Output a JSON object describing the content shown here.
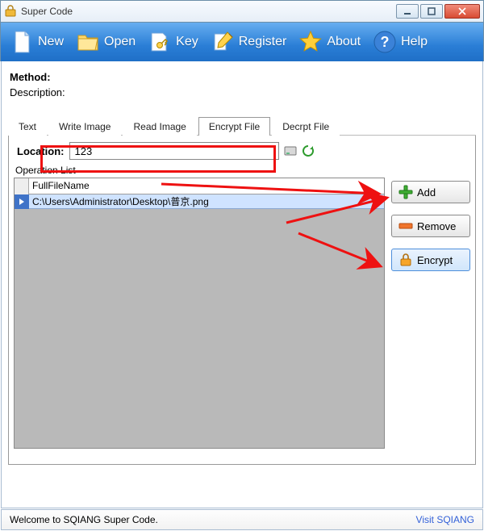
{
  "window": {
    "title": "Super Code"
  },
  "toolbar": {
    "new": "New",
    "open": "Open",
    "key": "Key",
    "register": "Register",
    "about": "About",
    "help": "Help"
  },
  "meta": {
    "method_label": "Method:",
    "description_label": "Description:"
  },
  "tabs": {
    "text": "Text",
    "write_image": "Write Image",
    "read_image": "Read Image",
    "encrypt_file": "Encrypt File",
    "decrypt_file": "Decrpt File"
  },
  "encrypt_panel": {
    "location_label": "Location:",
    "location_value": "123",
    "operation_list_label": "Operation List",
    "column_header": "FullFileName",
    "rows": [
      {
        "full_file_name": "C:\\Users\\Administrator\\Desktop\\普京.png"
      }
    ],
    "buttons": {
      "add": "Add",
      "remove": "Remove",
      "encrypt": "Encrypt"
    }
  },
  "status": {
    "welcome": "Welcome to SQIANG Super Code.",
    "link": "Visit SQIANG"
  }
}
